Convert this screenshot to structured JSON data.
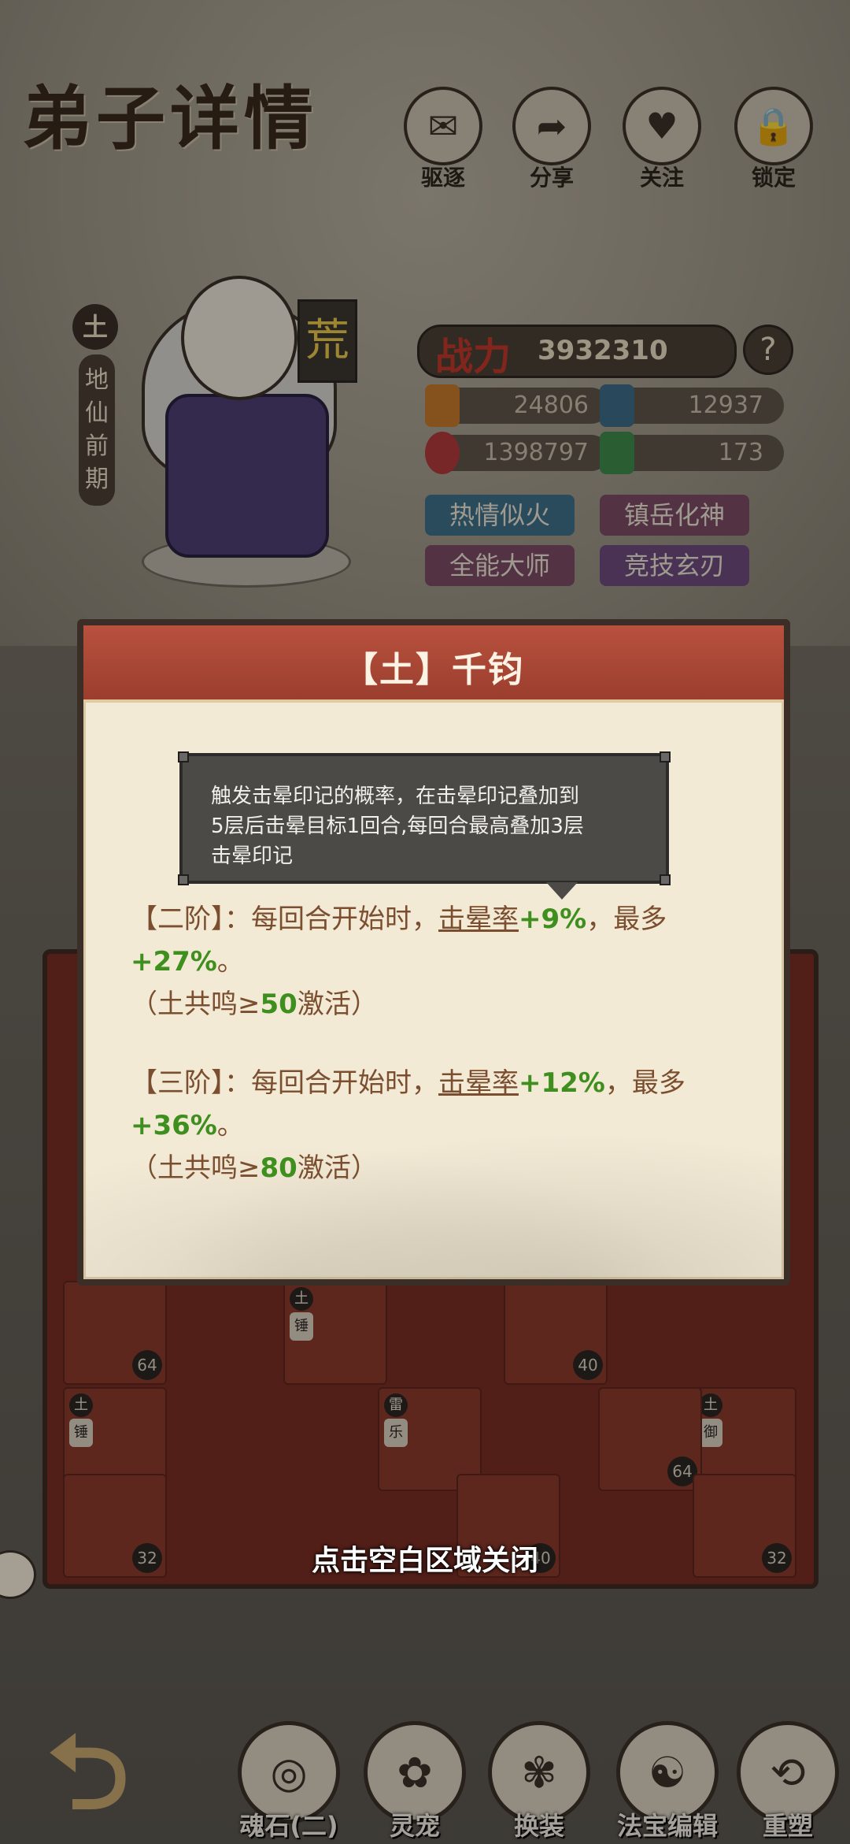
{
  "header": {
    "title": "弟子详情",
    "buttons": [
      {
        "label": "驱逐",
        "icon": "scroll-icon"
      },
      {
        "label": "分享",
        "icon": "share-icon"
      },
      {
        "label": "关注",
        "icon": "heart-icon"
      },
      {
        "label": "锁定",
        "icon": "lock-icon"
      }
    ]
  },
  "character": {
    "element": "土",
    "realm": [
      "地",
      "仙",
      "前",
      "期"
    ],
    "huang": "荒",
    "power_label": "战力",
    "power_value": "3932310",
    "stats": {
      "attack": "24806",
      "defense": "12937",
      "hp": "1398797",
      "speed": "173"
    },
    "tags": [
      "热情似火",
      "镇岳化神",
      "全能大师",
      "竞技玄刃"
    ]
  },
  "popup": {
    "title": "【土】千钧",
    "tier2": {
      "prefix": "【二阶】：每回合开始时，",
      "link": "击晕率",
      "bonus": "+9%",
      "mid": "，最多",
      "max": "+27%",
      "suffix": "。",
      "cond_pre": "（土共鸣≥",
      "cond_val": "50",
      "cond_post": "激活）"
    },
    "tier3": {
      "prefix": "【三阶】：每回合开始时，",
      "link": "击晕率",
      "bonus": "+12%",
      "mid": "，最多",
      "max": "+36%",
      "suffix": "。",
      "cond_pre": "（土共鸣≥",
      "cond_val": "80",
      "cond_post": "激活）"
    }
  },
  "tooltip": {
    "line1": "触发击晕印记的概率，在击晕印记叠加到",
    "line2": "5层后击晕目标1回合,每回合最高叠加3层",
    "line3": "击晕印记"
  },
  "close_hint": "点击空白区域关闭",
  "grid_levels": [
    "64",
    "40",
    "32",
    "40",
    "64",
    "32"
  ],
  "grid_badges": [
    "土",
    "锤",
    "土",
    "锤",
    "雷",
    "乐",
    "土",
    "御"
  ],
  "bottom_nav": [
    {
      "label": "魂石(二)",
      "icon": "soul-stone-icon"
    },
    {
      "label": "灵宠",
      "icon": "pet-icon"
    },
    {
      "label": "换装",
      "icon": "outfit-icon"
    },
    {
      "label": "法宝编辑",
      "icon": "treasure-icon"
    },
    {
      "label": "重塑",
      "icon": "reshape-icon"
    }
  ],
  "colors": {
    "accent_red": "#b8513e",
    "bonus_green": "#3e8f1e",
    "text_brown": "#7a4e2f"
  }
}
